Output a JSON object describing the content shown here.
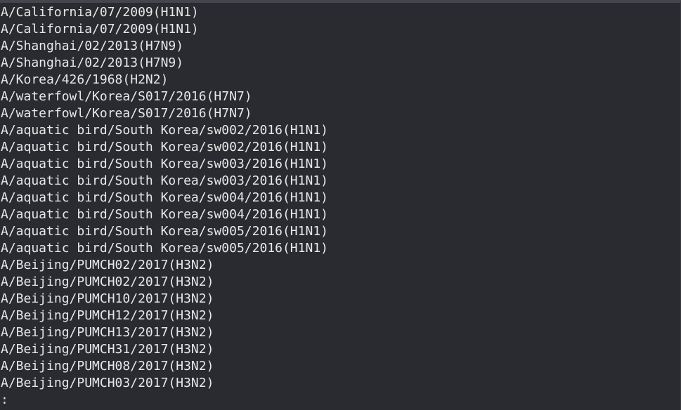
{
  "terminal": {
    "lines": [
      "A/California/07/2009(H1N1)",
      "A/California/07/2009(H1N1)",
      "A/Shanghai/02/2013(H7N9)",
      "A/Shanghai/02/2013(H7N9)",
      "A/Korea/426/1968(H2N2)",
      "A/waterfowl/Korea/S017/2016(H7N7)",
      "A/waterfowl/Korea/S017/2016(H7N7)",
      "A/aquatic bird/South Korea/sw002/2016(H1N1)",
      "A/aquatic bird/South Korea/sw002/2016(H1N1)",
      "A/aquatic bird/South Korea/sw003/2016(H1N1)",
      "A/aquatic bird/South Korea/sw003/2016(H1N1)",
      "A/aquatic bird/South Korea/sw004/2016(H1N1)",
      "A/aquatic bird/South Korea/sw004/2016(H1N1)",
      "A/aquatic bird/South Korea/sw005/2016(H1N1)",
      "A/aquatic bird/South Korea/sw005/2016(H1N1)",
      "A/Beijing/PUMCH02/2017(H3N2)",
      "A/Beijing/PUMCH02/2017(H3N2)",
      "A/Beijing/PUMCH10/2017(H3N2)",
      "A/Beijing/PUMCH12/2017(H3N2)",
      "A/Beijing/PUMCH13/2017(H3N2)",
      "A/Beijing/PUMCH31/2017(H3N2)",
      "A/Beijing/PUMCH08/2017(H3N2)",
      "A/Beijing/PUMCH03/2017(H3N2)"
    ],
    "pager_prompt": ":"
  }
}
